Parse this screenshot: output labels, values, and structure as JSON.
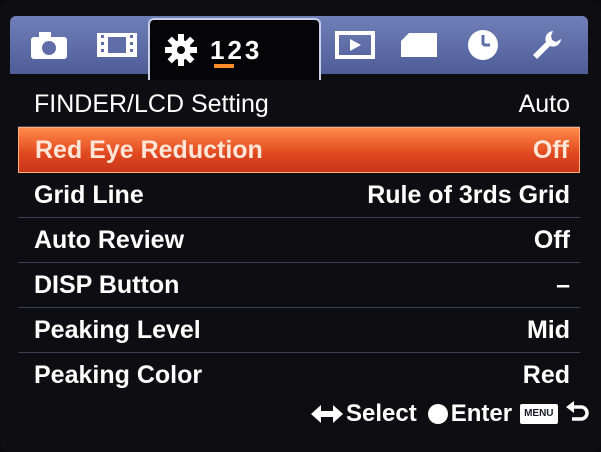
{
  "tabs": [
    {
      "icon": "camera-icon"
    },
    {
      "icon": "film-icon"
    },
    {
      "icon": "gear-icon",
      "pages": "123",
      "active": true
    },
    {
      "icon": "playback-icon"
    },
    {
      "icon": "memory-card-icon"
    },
    {
      "icon": "clock-icon"
    },
    {
      "icon": "wrench-icon"
    }
  ],
  "menu": [
    {
      "label": "FINDER/LCD Setting",
      "value": "Auto"
    },
    {
      "label": "Red Eye Reduction",
      "value": "Off",
      "selected": true
    },
    {
      "label": "Grid Line",
      "value": "Rule of 3rds Grid"
    },
    {
      "label": "Auto Review",
      "value": "Off"
    },
    {
      "label": "DISP Button",
      "value": "–"
    },
    {
      "label": "Peaking Level",
      "value": "Mid"
    },
    {
      "label": "Peaking Color",
      "value": "Red"
    }
  ],
  "footer": {
    "select_label": "Select",
    "enter_label": "Enter",
    "menu_badge": "MENU"
  },
  "colors": {
    "tab_bar": "#5f6ea8",
    "highlight": "#e8521f",
    "background": "#0d0d12"
  }
}
